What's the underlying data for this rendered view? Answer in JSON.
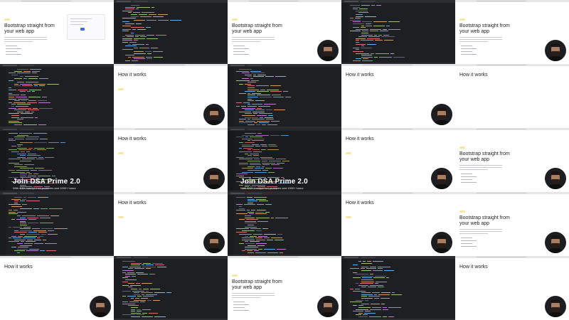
{
  "tiles": [
    {
      "kind": "page",
      "variant": "bootstrap",
      "cam": false,
      "pill": true,
      "heading": "Bootstrap straight from your web app"
    },
    {
      "kind": "editor",
      "cam": false
    },
    {
      "kind": "page",
      "variant": "bootstrap",
      "cam": true,
      "pill": true,
      "heading": "Bootstrap straight from your web app"
    },
    {
      "kind": "editor",
      "cam": false
    },
    {
      "kind": "page",
      "variant": "bootstrap",
      "cam": true,
      "pill": true,
      "heading": "Bootstrap straight from your web app"
    },
    {
      "kind": "editor",
      "cam": false
    },
    {
      "kind": "page",
      "variant": "how",
      "cam": true,
      "pill": true,
      "heading": "How it works"
    },
    {
      "kind": "editor",
      "cam": false
    },
    {
      "kind": "page",
      "variant": "how",
      "cam": true,
      "pill": false,
      "heading": "How it works"
    },
    {
      "kind": "page",
      "variant": "how",
      "cam": false,
      "pill": false,
      "heading": "How it works"
    },
    {
      "kind": "titleov",
      "cam": false,
      "title": "Join DSA Prime 2.0",
      "subtitle": "With 400+ handpicked problems and 1000+ hours"
    },
    {
      "kind": "page",
      "variant": "how",
      "cam": true,
      "pill": true,
      "heading": "How it works"
    },
    {
      "kind": "titleov",
      "cam": false,
      "title": "Join DSA Prime 2.0",
      "subtitle": "With 400+ handpicked problems and 1000+ hours"
    },
    {
      "kind": "page",
      "variant": "how",
      "cam": true,
      "pill": true,
      "heading": "How it works"
    },
    {
      "kind": "page",
      "variant": "bootstrap",
      "cam": true,
      "pill": true,
      "heading": "Bootstrap straight from your web app"
    },
    {
      "kind": "editor",
      "cam": false
    },
    {
      "kind": "page",
      "variant": "how",
      "cam": true,
      "pill": true,
      "heading": "How it works"
    },
    {
      "kind": "editor",
      "cam": false
    },
    {
      "kind": "page",
      "variant": "how",
      "cam": true,
      "pill": true,
      "heading": "How it works"
    },
    {
      "kind": "page",
      "variant": "bootstrap",
      "cam": true,
      "pill": true,
      "heading": "Bootstrap straight from your web app"
    },
    {
      "kind": "page",
      "variant": "how",
      "cam": true,
      "pill": false,
      "heading": "How it works"
    },
    {
      "kind": "editor",
      "cam": false
    },
    {
      "kind": "page",
      "variant": "bootstrap",
      "cam": true,
      "pill": true,
      "heading": "Bootstrap straight from your web app"
    },
    {
      "kind": "editor",
      "cam": false
    },
    {
      "kind": "page",
      "variant": "how",
      "cam": true,
      "pill": false,
      "heading": "How it works"
    }
  ],
  "colors": {
    "keyword": "#c678dd",
    "tag": "#e06c75",
    "attr": "#d19a66",
    "string": "#98c379",
    "plain": "#8b95a5",
    "comment": "#5c6370",
    "func": "#61afef"
  }
}
